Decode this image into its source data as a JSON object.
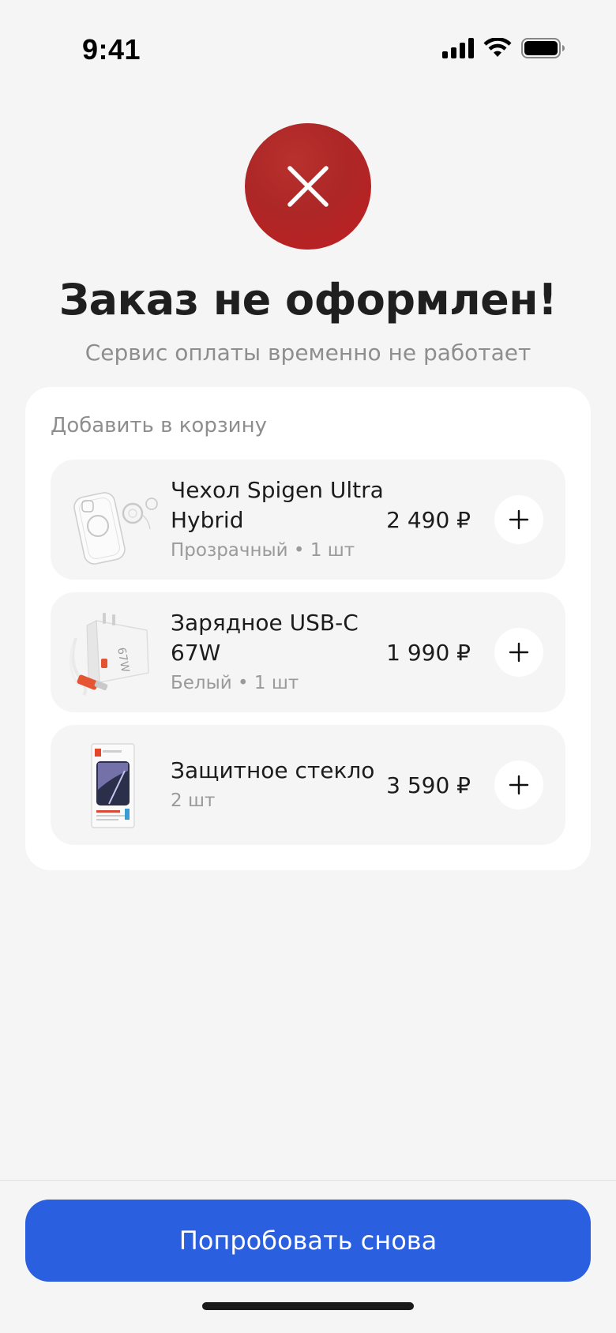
{
  "status_bar": {
    "time": "9:41",
    "icons": [
      "signal-icon",
      "wifi-icon",
      "battery-icon"
    ]
  },
  "error": {
    "icon": "close-icon",
    "color": "#b8282a",
    "title": "Заказ не оформлен!",
    "subtitle": "Сервис оплаты временно не работает"
  },
  "upsell": {
    "heading": "Добавить в корзину",
    "items": [
      {
        "name": "Чехол Spigen Ultra Hybrid",
        "meta": "Прозрачный • 1 шт",
        "price": "2 490 ₽",
        "thumb": "clear-case-image",
        "add_icon": "plus-icon"
      },
      {
        "name": "Зарядное USB-C 67W",
        "meta": "Белый • 1 шт",
        "price": "1 990 ₽",
        "thumb": "usb-charger-image",
        "add_icon": "plus-icon"
      },
      {
        "name": "Защитное стекло",
        "meta": "2 шт",
        "price": "3 590 ₽",
        "thumb": "screen-protector-image",
        "add_icon": "plus-icon"
      }
    ]
  },
  "footer": {
    "retry_label": "Попробовать снова",
    "accent_color": "#2a5fe0"
  }
}
